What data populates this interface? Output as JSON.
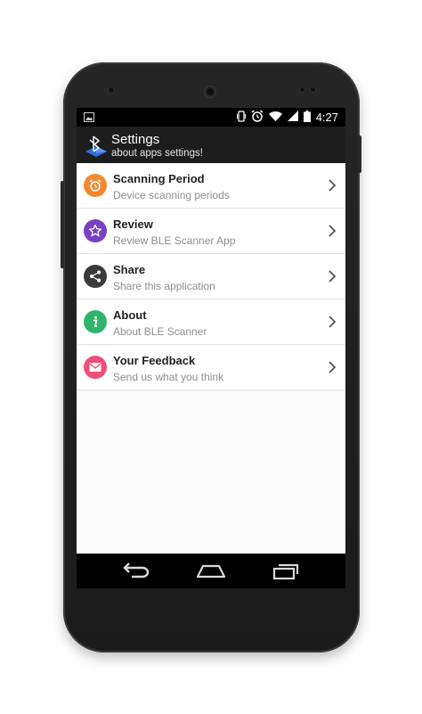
{
  "status_bar": {
    "time": "4:27"
  },
  "app_bar": {
    "title": "Settings",
    "subtitle": "about apps settings!"
  },
  "items": [
    {
      "label": "Scanning Period",
      "sub": "Device scanning periods",
      "icon": "alarm-icon",
      "color": "#f3892e"
    },
    {
      "label": "Review",
      "sub": "Review BLE Scanner App",
      "icon": "star-icon",
      "color": "#7b3fc2"
    },
    {
      "label": "Share",
      "sub": "Share this application",
      "icon": "share-icon",
      "color": "#3a3a3a"
    },
    {
      "label": "About",
      "sub": "About BLE Scanner",
      "icon": "info-icon",
      "color": "#2fb56a"
    },
    {
      "label": "Your Feedback",
      "sub": "Send us what you think",
      "icon": "mail-icon",
      "color": "#ec4f79"
    }
  ],
  "nav_bar": {
    "buttons": [
      "back-icon",
      "home-icon",
      "recents-icon"
    ]
  }
}
